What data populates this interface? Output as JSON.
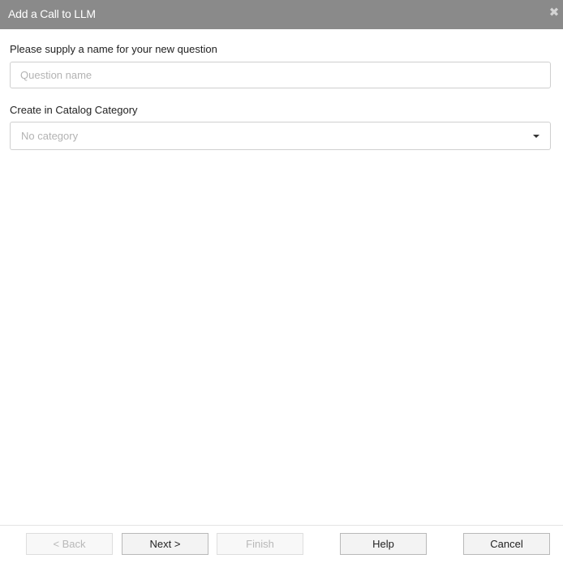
{
  "dialog": {
    "title": "Add a Call to LLM",
    "close_glyph": "✖"
  },
  "form": {
    "name_label": "Please supply a name for your new question",
    "name_value": "",
    "name_placeholder": "Question name",
    "category_label": "Create in Catalog Category",
    "category_selected": "No category"
  },
  "footer": {
    "back_label": "< Back",
    "next_label": "Next >",
    "finish_label": "Finish",
    "help_label": "Help",
    "cancel_label": "Cancel"
  },
  "colors": {
    "titlebar_bg": "#8a8a8a",
    "titlebar_text": "#ffffff",
    "disabled_text": "#b8b8b8"
  }
}
